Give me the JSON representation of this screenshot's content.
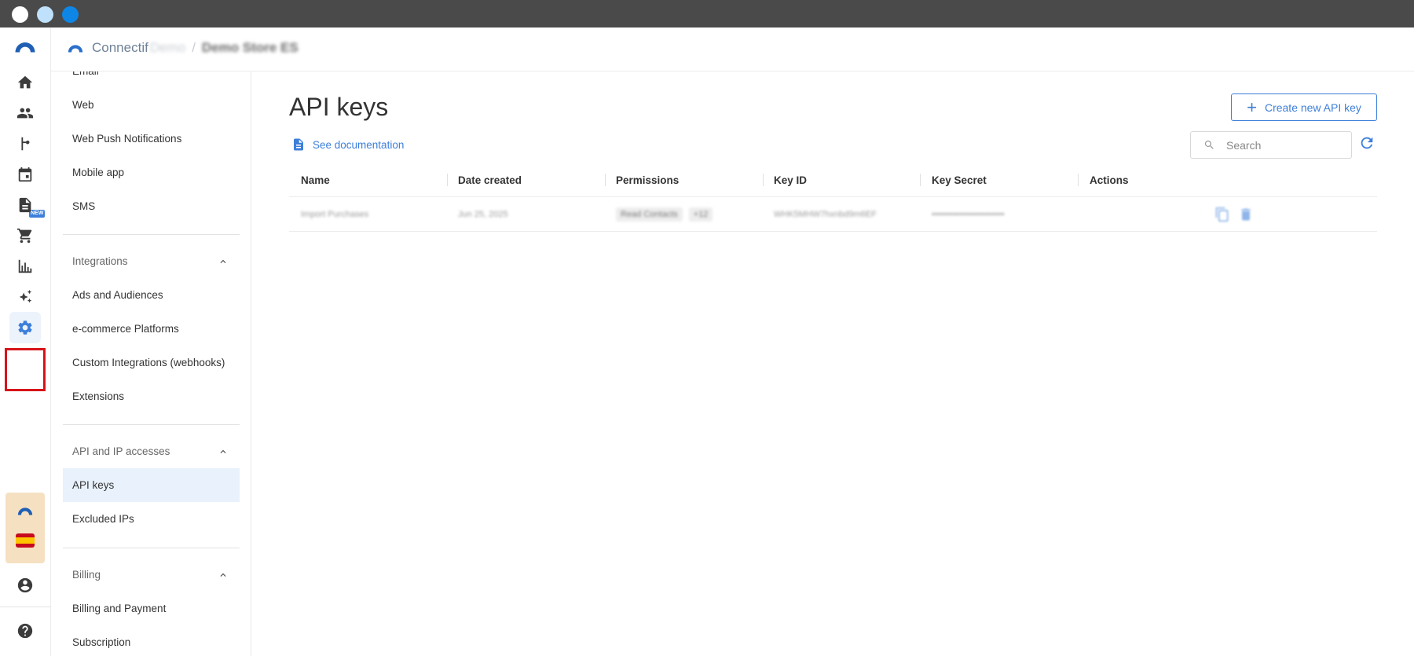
{
  "window": {
    "controls": [
      "close",
      "minimize",
      "maximize"
    ]
  },
  "header": {
    "brand": "Connectif",
    "account": "Demo",
    "separator": "/",
    "store": "Demo Store ES"
  },
  "rail": {
    "items": [
      {
        "icon": "home-icon"
      },
      {
        "icon": "contacts-icon"
      },
      {
        "icon": "workflow-icon"
      },
      {
        "icon": "calendar-icon",
        "badge": "NEW"
      },
      {
        "icon": "document-icon"
      },
      {
        "icon": "cart-icon"
      },
      {
        "icon": "reports-icon"
      },
      {
        "icon": "ai-sparkle-icon"
      },
      {
        "icon": "settings-icon",
        "active": true
      },
      {
        "icon": "account-icon"
      },
      {
        "icon": "help-icon"
      }
    ]
  },
  "subnav": {
    "channels": [
      "Email",
      "Web",
      "Web Push Notifications",
      "Mobile app",
      "SMS"
    ],
    "integrations": {
      "title": "Integrations",
      "items": [
        "Ads and Audiences",
        "e-commerce Platforms",
        "Custom Integrations (webhooks)",
        "Extensions"
      ]
    },
    "api": {
      "title": "API and IP accesses",
      "items": [
        "API keys",
        "Excluded IPs"
      ]
    },
    "billing": {
      "title": "Billing",
      "items": [
        "Billing and Payment",
        "Subscription"
      ]
    }
  },
  "main": {
    "title": "API keys",
    "doc_link": "See documentation",
    "create_button": "Create new API key",
    "search_placeholder": "Search",
    "table": {
      "headers": [
        "Name",
        "Date created",
        "Permissions",
        "Key ID",
        "Key Secret",
        "Actions"
      ],
      "rows": [
        {
          "name": "Import Purchases",
          "date_created": "Jun 25, 2025",
          "permissions": [
            "Read Contacts",
            "+12"
          ],
          "key_id": "WHK5MHW7hxnbd9m6EF",
          "key_secret": "••••••••••••••••••••••••"
        }
      ]
    }
  },
  "colors": {
    "accent": "#3d7fd9",
    "highlight": "#d6141a",
    "titlebar": "#4a4a4a"
  }
}
